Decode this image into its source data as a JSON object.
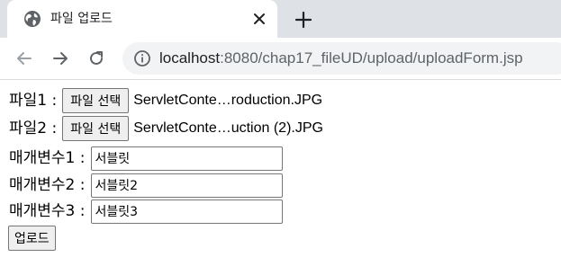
{
  "browser": {
    "tab": {
      "title": "파일 업로드",
      "favicon_icon": "globe-icon",
      "close_icon": "close-icon"
    },
    "new_tab_icon": "plus-icon",
    "toolbar": {
      "back_icon": "arrow-left-icon",
      "forward_icon": "arrow-right-icon",
      "reload_icon": "reload-icon",
      "info_icon": "info-icon",
      "url_host": "localhost",
      "url_rest": ":8080/chap17_fileUD/upload/uploadForm.jsp"
    }
  },
  "form": {
    "file1": {
      "label": "파일1 :",
      "button_label": "파일 선택",
      "file_name": "ServletConte…roduction.JPG"
    },
    "file2": {
      "label": "파일2 :",
      "button_label": "파일 선택",
      "file_name": "ServletConte…uction (2).JPG"
    },
    "param1": {
      "label": "매개변수1 :",
      "value": "서블릿"
    },
    "param2": {
      "label": "매개변수2 :",
      "value": "서블릿2"
    },
    "param3": {
      "label": "매개변수3 :",
      "value": "서블릿3"
    },
    "submit_label": "업로드"
  },
  "colors": {
    "tabstrip_bg": "#dee1e6",
    "omnibox_bg": "#f1f3f4",
    "icon_gray": "#5f6368",
    "button_bg": "#efefef"
  }
}
